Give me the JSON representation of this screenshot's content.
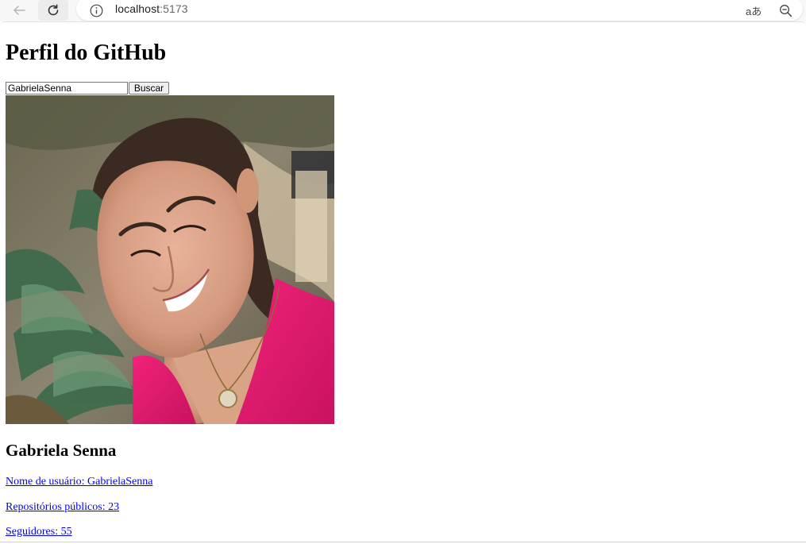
{
  "browser": {
    "url_host": "localhost",
    "url_port": ":5173",
    "translate_label": "aあ"
  },
  "page": {
    "title": "Perfil do GitHub",
    "search": {
      "value": "GabrielaSenna",
      "button_label": "Buscar"
    },
    "profile": {
      "name": "Gabriela Senna",
      "username_link": "Nome de usuário: GabrielaSenna",
      "repos_link": "Repositórios públicos: 23",
      "followers_link": "Seguidores: 55"
    }
  },
  "colors": {
    "link": "#0000ee",
    "shirt": "#e0176e"
  }
}
